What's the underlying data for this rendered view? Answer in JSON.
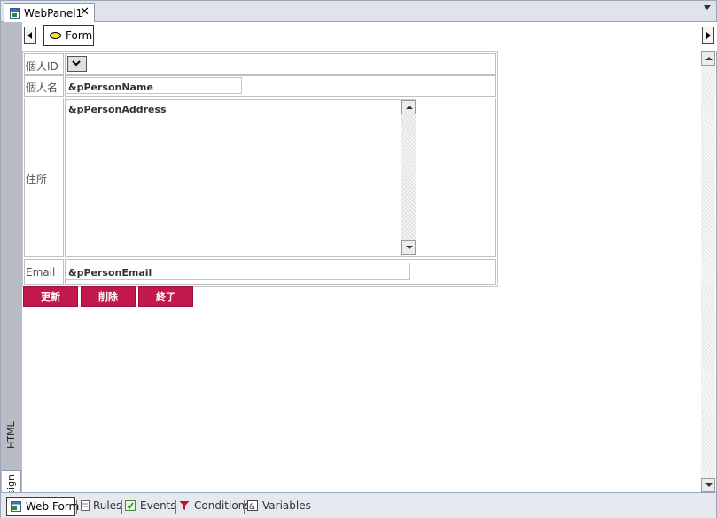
{
  "document_tab": {
    "title": "WebPanel1",
    "close_glyph": "✕",
    "icon": "web-panel-icon"
  },
  "breadcrumb": {
    "back_icon": "left-arrow-icon",
    "forward_icon": "right-arrow-icon",
    "form_label": "Form",
    "form_icon": "oval-icon"
  },
  "side_tabs": {
    "html": "HTML",
    "design": "Design"
  },
  "form": {
    "rows": [
      {
        "label": "個人ID",
        "control": "combo"
      },
      {
        "label": "個人名",
        "value": "&pPersonName"
      },
      {
        "label": "住所",
        "value": "&pPersonAddress"
      },
      {
        "label": "Email",
        "value": "&pPersonEmail"
      }
    ]
  },
  "buttons": {
    "update": "更新",
    "delete": "削除",
    "finish": "終了"
  },
  "bottom_tabs": [
    {
      "label": "Web Form",
      "icon": "web-form-icon",
      "active": true
    },
    {
      "label": "Rules",
      "icon": "rules-icon",
      "active": false
    },
    {
      "label": "Events",
      "icon": "events-icon",
      "active": false
    },
    {
      "label": "Conditions",
      "icon": "filter-icon",
      "active": false
    },
    {
      "label": "Variables",
      "icon": "variables-icon",
      "active": false
    }
  ],
  "colors": {
    "button_bg": "#c2184d",
    "chrome_bg": "#dfe3ea",
    "side_strip": "#b8bcc3"
  }
}
